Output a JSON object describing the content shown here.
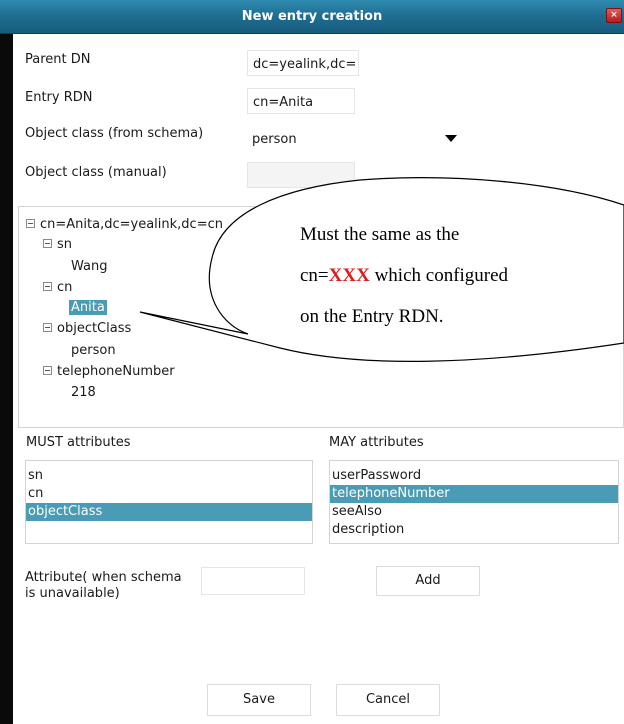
{
  "window": {
    "title": "New entry creation",
    "close_glyph": "×"
  },
  "form": {
    "parent_dn_label": "Parent DN",
    "parent_dn_value": "dc=yealink,dc=",
    "entry_rdn_label": "Entry RDN",
    "entry_rdn_value": "cn=Anita",
    "object_class_schema_label": "Object class (from schema)",
    "object_class_schema_value": "person",
    "object_class_manual_label": "Object class (manual)",
    "object_class_manual_value": ""
  },
  "tree": {
    "root": "cn=Anita,dc=yealink,dc=cn",
    "nodes": [
      {
        "name": "sn",
        "value": "Wang"
      },
      {
        "name": "cn",
        "value": "Anita"
      },
      {
        "name": "objectClass",
        "value": "person"
      },
      {
        "name": "telephoneNumber",
        "value": "218"
      }
    ]
  },
  "callout": {
    "line1": "Must   the   same   as   the",
    "line2_prefix": "cn=",
    "line2_highlight": "XXX",
    "line2_suffix": " which configured",
    "line3": "on the Entry RDN."
  },
  "must": {
    "header": "MUST attributes",
    "items": [
      "sn",
      "cn",
      "objectClass"
    ],
    "selected_index": 2
  },
  "may": {
    "header": "MAY attributes",
    "items": [
      "userPassword",
      "telephoneNumber",
      "seeAlso",
      "description"
    ],
    "selected_index": 1
  },
  "attribute": {
    "label_line1": "Attribute( when schema",
    "label_line2": "is unavailable)",
    "value": "",
    "add_label": "Add"
  },
  "footer": {
    "save_label": "Save",
    "cancel_label": "Cancel"
  },
  "colors": {
    "title_bar": "#1f6f93",
    "selection": "#4a9bb5",
    "callout_highlight": "#e0191a"
  }
}
